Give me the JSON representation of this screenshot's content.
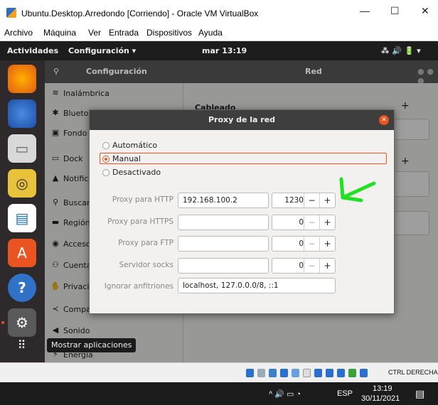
{
  "window": {
    "title": "Ubuntu.Desktop.Arredondo [Corriendo] - Oracle VM VirtualBox",
    "min": "—",
    "max": "☐",
    "close": "✕",
    "menu": [
      "Archivo",
      "Máquina",
      "Ver",
      "Entrada",
      "Dispositivos",
      "Ayuda"
    ]
  },
  "topbar": {
    "activities": "Actividades",
    "app_menu": "Configuración ▾",
    "clock": "mar 13:19",
    "tray": "⁂  🔊  🔋 ▾"
  },
  "settings": {
    "sidebar_title": "Configuración",
    "main_title": "Red",
    "sidebar_items": [
      {
        "icon": "wifi-icon",
        "glyph": "≋",
        "label": "Inalámbrica"
      },
      {
        "icon": "bluetooth-icon",
        "glyph": "✱",
        "label": "Blueto"
      },
      {
        "icon": "background-icon",
        "glyph": "▣",
        "label": "Fondo"
      },
      {
        "icon": "dock-icon",
        "glyph": "▭",
        "label": "Dock"
      },
      {
        "icon": "bell-icon",
        "glyph": "▲",
        "label": "Notific"
      },
      {
        "icon": "search-icon",
        "glyph": "⚲",
        "label": "Buscar"
      },
      {
        "icon": "region-icon",
        "glyph": "▬",
        "label": "Región"
      },
      {
        "icon": "accessibility-icon",
        "glyph": "◉",
        "label": "Acceso"
      },
      {
        "icon": "accounts-icon",
        "glyph": "⚇",
        "label": "Cuenta"
      },
      {
        "icon": "privacy-icon",
        "glyph": "✋",
        "label": "Privaci"
      },
      {
        "icon": "share-icon",
        "glyph": "≺",
        "label": "Compa"
      },
      {
        "icon": "sound-icon",
        "glyph": "◀",
        "label": "Sonido"
      },
      {
        "icon": "power-icon",
        "glyph": "⚡",
        "label": "Energía"
      }
    ],
    "section": "Cableado"
  },
  "dialog": {
    "title": "Proxy de la red",
    "modes": [
      "Automático",
      "Manual",
      "Desactivado"
    ],
    "selected_mode": "Manual",
    "fields": [
      {
        "label": "Proxy para HTTP",
        "host": "192.168.100.2",
        "port": "1230"
      },
      {
        "label": "Proxy para HTTPS",
        "host": "",
        "port": "0"
      },
      {
        "label": "Proxy para FTP",
        "host": "",
        "port": "0"
      },
      {
        "label": "Servidor socks",
        "host": "",
        "port": "0"
      }
    ],
    "ignore_label": "Ignorar anfitriones",
    "ignore_value": "localhost, 127.0.0.0/8, ::1",
    "minus": "−",
    "plus": "+"
  },
  "tooltip": "Mostrar aplicaciones",
  "vbox_status": {
    "host_key": "CTRL DERECHA"
  },
  "taskbar": {
    "tray": "^  🔊  ▭  ◔",
    "lang": "ESP",
    "time": "13:19",
    "date": "30/11/2021"
  },
  "colors": {
    "accent": "#e95420",
    "annotation": "#22e022"
  }
}
